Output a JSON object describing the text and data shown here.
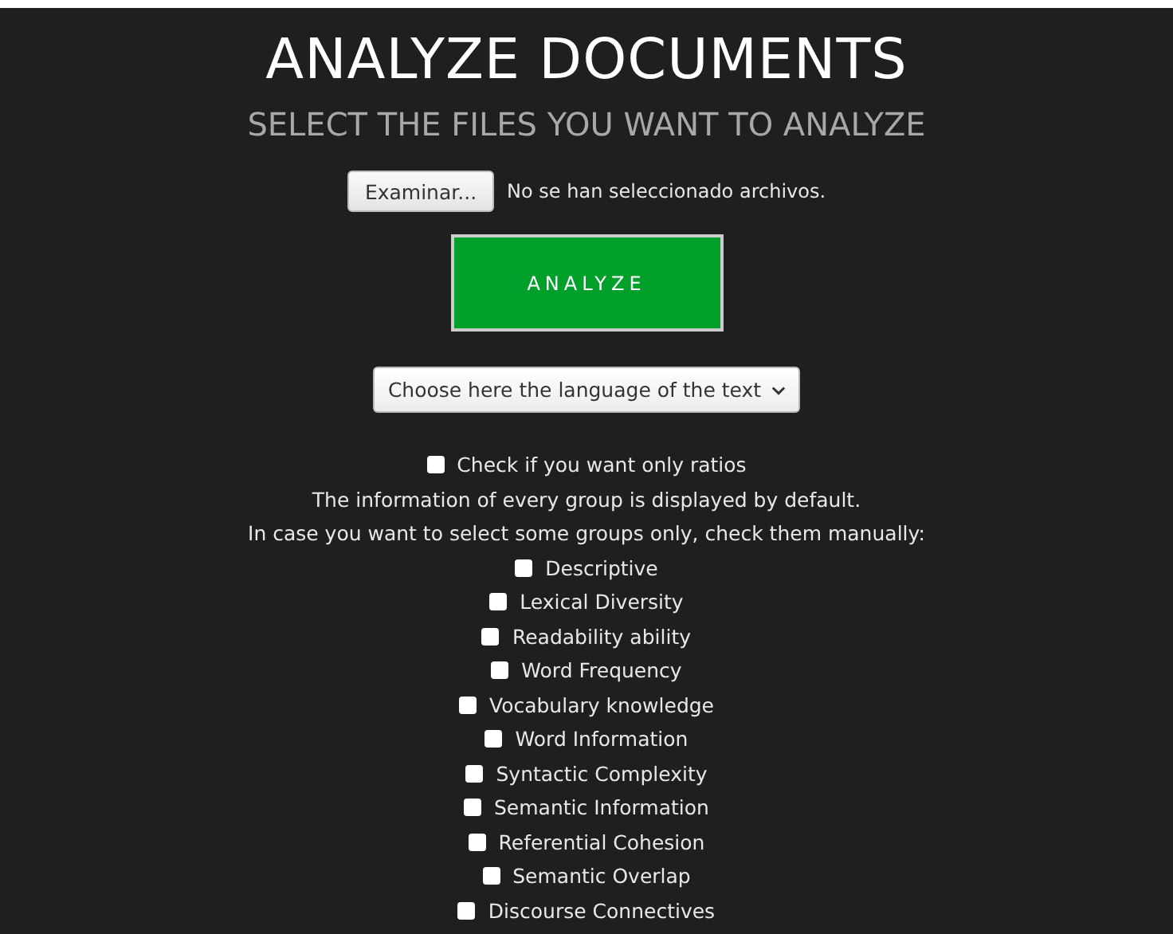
{
  "title": "ANALYZE DOCUMENTS",
  "subtitle": "SELECT THE FILES YOU WANT TO ANALYZE",
  "file_picker": {
    "button": "Examinar...",
    "status": "No se han seleccionado archivos."
  },
  "analyze_button": "ANALYZE",
  "language_select": {
    "value": "Choose here the language of the text"
  },
  "ratios_option": {
    "label": "Check if you want only ratios",
    "checked": false
  },
  "notes": [
    "The information of every group is displayed by default.",
    "In case you want to select some groups only, check them manually:"
  ],
  "groups": [
    {
      "label": "Descriptive",
      "checked": false
    },
    {
      "label": "Lexical Diversity",
      "checked": false
    },
    {
      "label": "Readability ability",
      "checked": false
    },
    {
      "label": "Word Frequency",
      "checked": false
    },
    {
      "label": "Vocabulary knowledge",
      "checked": false
    },
    {
      "label": "Word Information",
      "checked": false
    },
    {
      "label": "Syntactic Complexity",
      "checked": false
    },
    {
      "label": "Semantic Information",
      "checked": false
    },
    {
      "label": "Referential Cohesion",
      "checked": false
    },
    {
      "label": "Semantic Overlap",
      "checked": false
    },
    {
      "label": "Discourse Connectives",
      "checked": false
    }
  ]
}
